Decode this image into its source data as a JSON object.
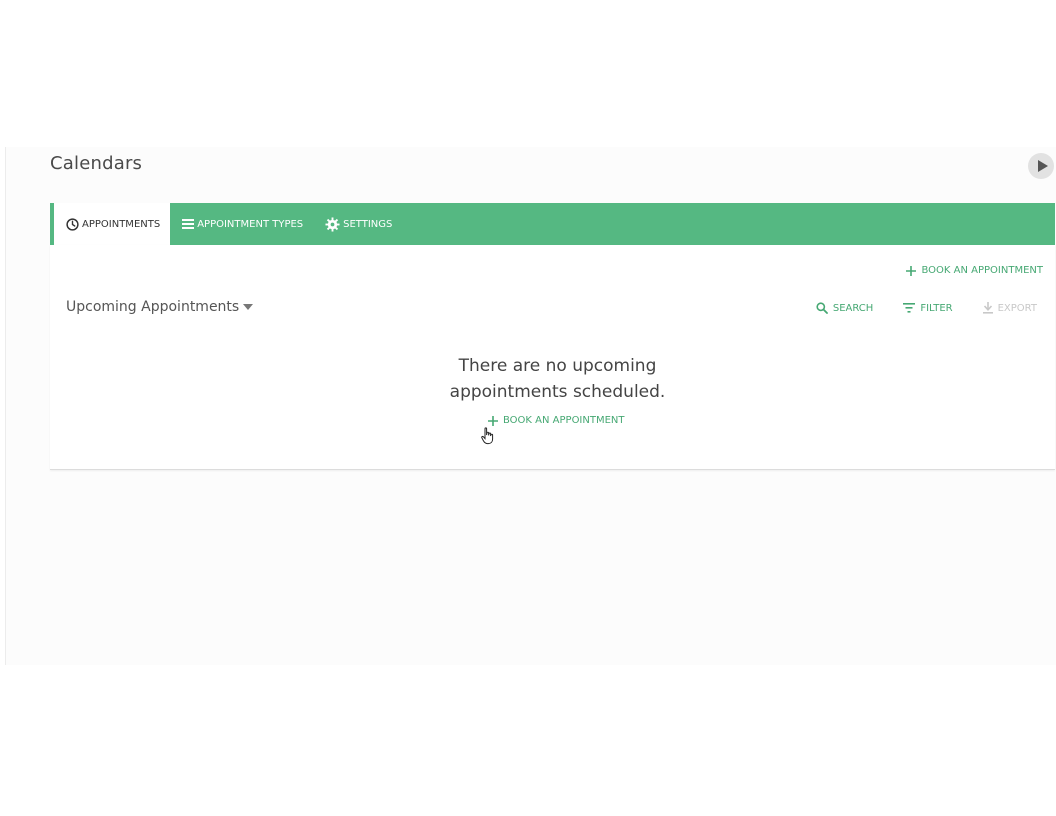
{
  "page": {
    "title": "Calendars"
  },
  "colors": {
    "accent": "#55b882",
    "accent_text": "#46a873",
    "disabled": "#c8c8c8"
  },
  "tabs": [
    {
      "label": "APPOINTMENTS",
      "icon": "clock-icon",
      "active": true
    },
    {
      "label": "APPOINTMENT TYPES",
      "icon": "list-icon",
      "active": false
    },
    {
      "label": "SETTINGS",
      "icon": "gear-icon",
      "active": false
    }
  ],
  "actions": {
    "book_top_label": "BOOK AN APPOINTMENT",
    "book_center_label": "BOOK AN APPOINTMENT"
  },
  "section": {
    "title": "Upcoming Appointments",
    "dropdown_icon": "caret-down-icon"
  },
  "toolbar": {
    "search_label": "SEARCH",
    "filter_label": "FILTER",
    "export_label": "EXPORT"
  },
  "empty_state": {
    "line1": "There are no upcoming",
    "line2": "appointments scheduled."
  }
}
